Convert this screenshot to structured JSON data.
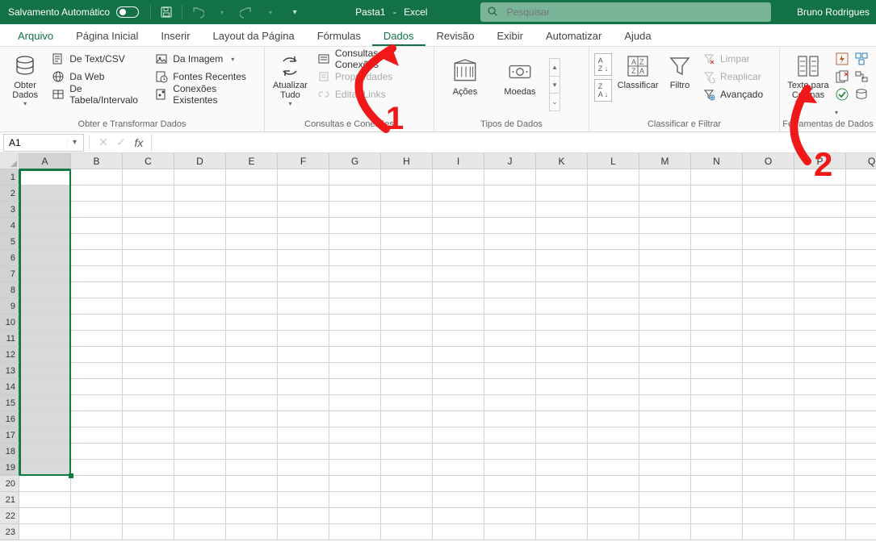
{
  "titlebar": {
    "autosave": "Salvamento Automático",
    "filename": "Pasta1",
    "app": "Excel",
    "search_placeholder": "Pesquisar",
    "user": "Bruno Rodrigues"
  },
  "tabs": [
    "Arquivo",
    "Página Inicial",
    "Inserir",
    "Layout da Página",
    "Fórmulas",
    "Dados",
    "Revisão",
    "Exibir",
    "Automatizar",
    "Ajuda"
  ],
  "active_tab": "Dados",
  "ribbon": {
    "g1": {
      "label": "Obter e Transformar Dados",
      "big": "Obter\nDados",
      "items": [
        "De Text/CSV",
        "Da Web",
        "De Tabela/Intervalo",
        "Da Imagem",
        "Fontes Recentes",
        "Conexões Existentes"
      ]
    },
    "g2": {
      "label": "Consultas e Conexões",
      "big": "Atualizar\nTudo",
      "items": [
        "Consultas e Conexões",
        "Propriedades",
        "Editar Links"
      ]
    },
    "g3": {
      "label": "Tipos de Dados",
      "items": [
        "Ações",
        "Moedas"
      ]
    },
    "g4": {
      "label": "Classificar e Filtrar",
      "sort": "Classificar",
      "filter": "Filtro",
      "items": [
        "Limpar",
        "Reaplicar",
        "Avançado"
      ]
    },
    "g5": {
      "label": "Ferramentas de Dados",
      "big": "Texto para\nColunas"
    }
  },
  "cellref": "A1",
  "columns": [
    "A",
    "B",
    "C",
    "D",
    "E",
    "F",
    "G",
    "H",
    "I",
    "J",
    "K",
    "L",
    "M",
    "N",
    "O",
    "P",
    "Q"
  ],
  "rows": 23,
  "selected_col": "A",
  "selected_rows_end": 19,
  "annotations": {
    "a1": "1",
    "a2": "2"
  }
}
